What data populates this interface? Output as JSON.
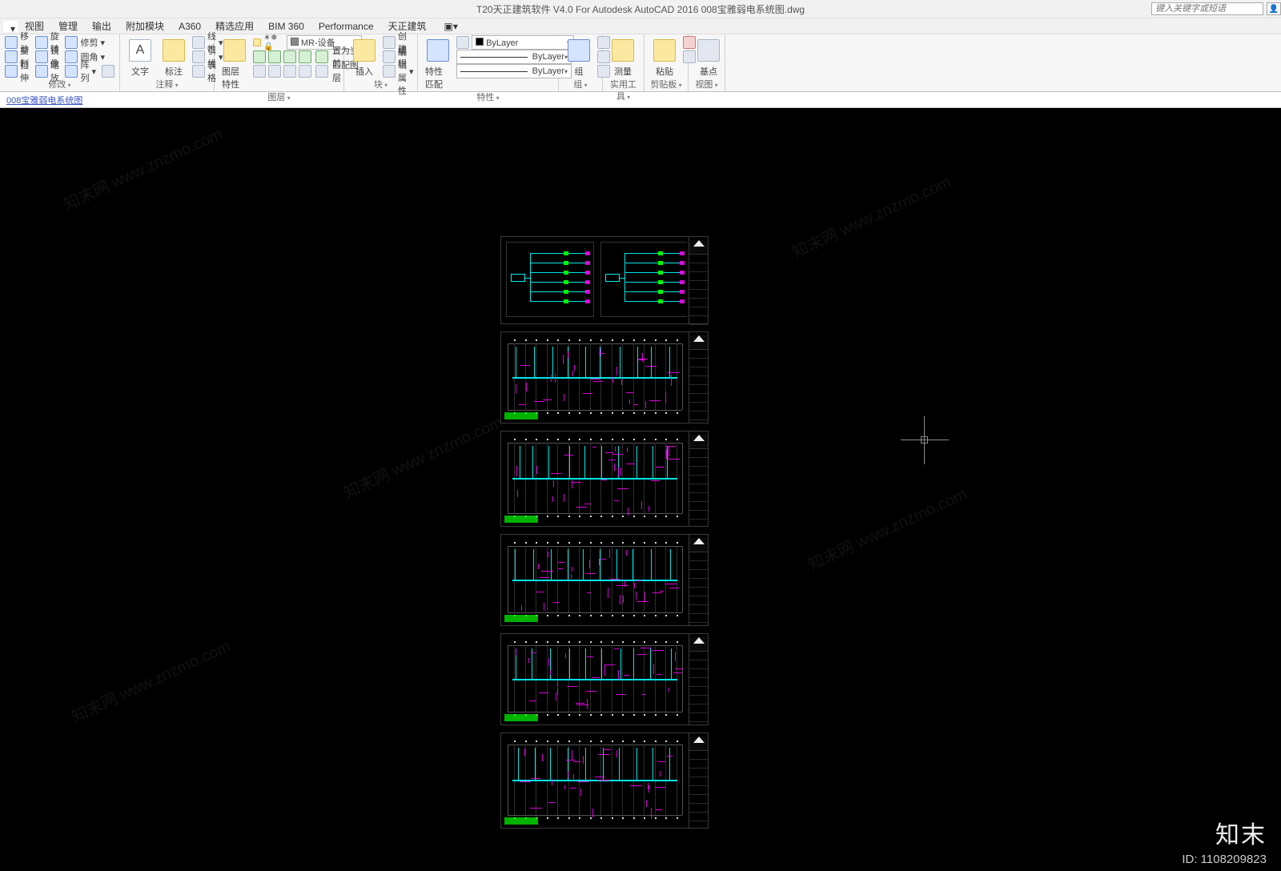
{
  "titlebar": {
    "title": "T20天正建筑软件 V4.0 For Autodesk AutoCAD 2016    008宝雅弱电系统图.dwg",
    "search_placeholder": "键入关键字或短语"
  },
  "menubar": {
    "items": [
      "视图",
      "管理",
      "输出",
      "附加模块",
      "A360",
      "精选应用",
      "BIM 360",
      "Performance",
      "天正建筑"
    ]
  },
  "ribbon": {
    "modify": {
      "label": "修改",
      "rows": [
        [
          "移动",
          "旋转",
          "修剪"
        ],
        [
          "复制",
          "镜像",
          "圆角"
        ],
        [
          "拉伸",
          "缩放",
          "阵列"
        ]
      ],
      "suffix": "表格"
    },
    "annotate": {
      "label": "注释",
      "big1": "文字",
      "big2": "标注",
      "rows": [
        [
          "线性"
        ],
        [
          "引线"
        ],
        [
          "表格"
        ]
      ]
    },
    "layers": {
      "label": "图层",
      "big": "图层特性",
      "dropdown": "MR-设备",
      "btns": [
        "置为当前",
        "匹配图层"
      ]
    },
    "block": {
      "label": "块",
      "big": "插入",
      "rows": [
        [
          "创建"
        ],
        [
          "编辑"
        ],
        [
          "编辑属性"
        ]
      ]
    },
    "props": {
      "label": "特性",
      "big": "特性匹配",
      "color": "ByLayer",
      "ltype": "ByLayer",
      "lweight": "ByLayer"
    },
    "group": {
      "label": "组",
      "big": "组"
    },
    "util": {
      "label": "实用工具",
      "big": "测量"
    },
    "clip": {
      "label": "剪贴板",
      "big": "粘贴"
    },
    "view": {
      "label": "视图",
      "big": "基点"
    }
  },
  "doc_tab": {
    "name": "008宝雅弱电系统图"
  },
  "watermark": {
    "brand": "知末",
    "id": "ID: 1108209823",
    "bg": "知末网 www.znzmo.com"
  }
}
